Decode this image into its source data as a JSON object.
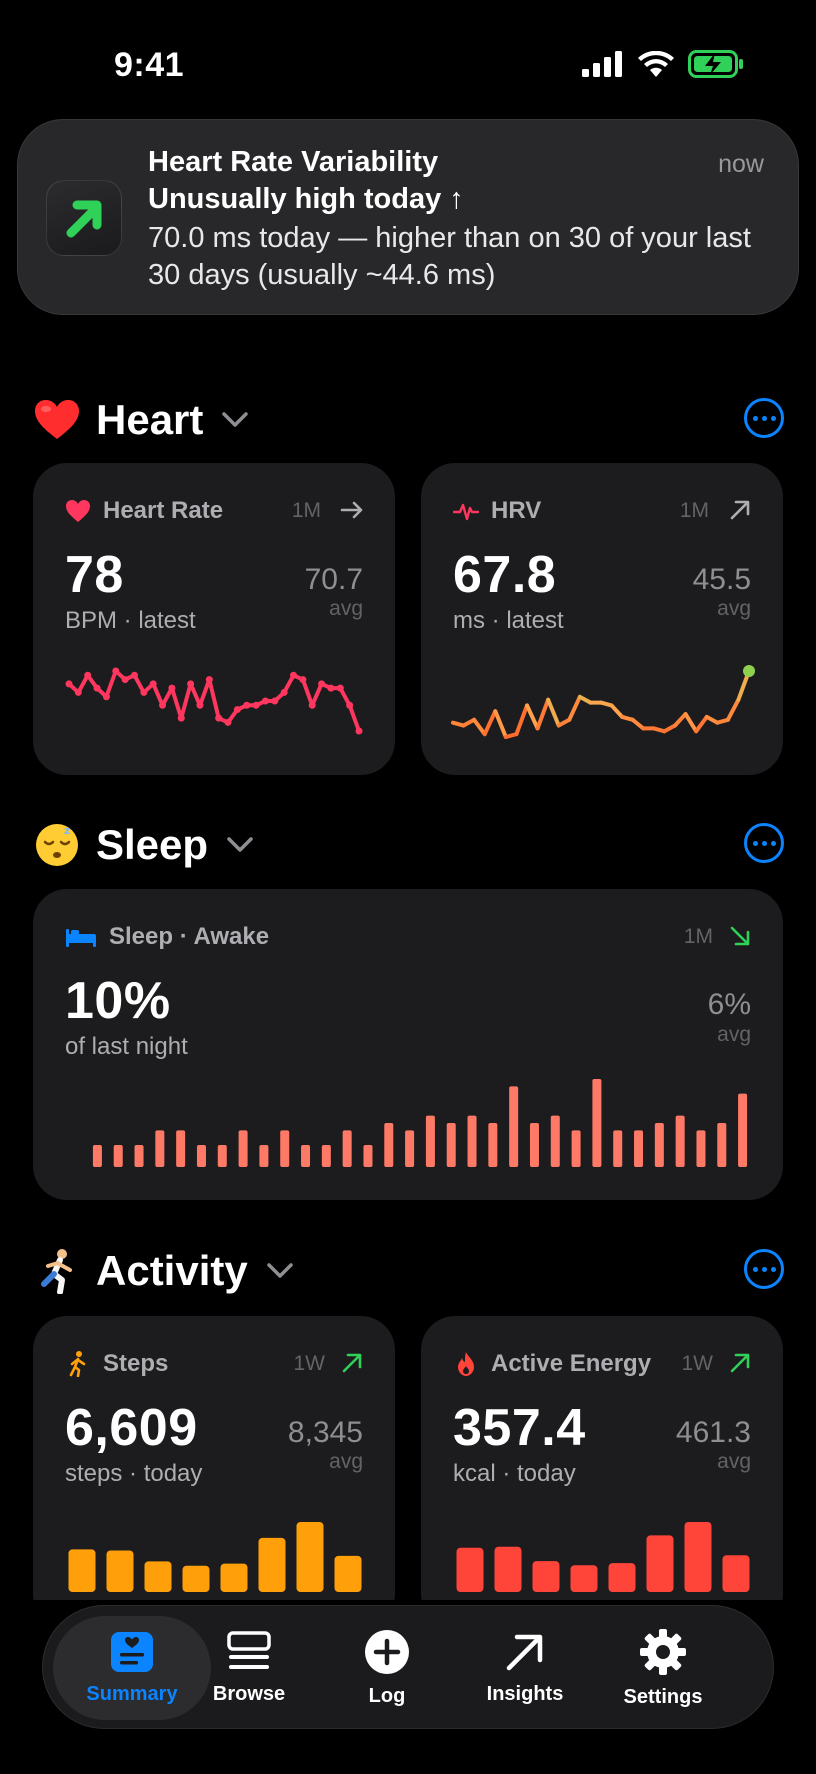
{
  "status_bar": {
    "time": "9:41"
  },
  "notification": {
    "title": "Heart Rate Variability",
    "subtitle": "Unusually high today ↑",
    "body": "70.0 ms today — higher than on 30 of your last 30 days (usually ~44.6 ms)",
    "time": "now"
  },
  "sections": {
    "heart": {
      "emoji": "heart-emoji",
      "title": "Heart"
    },
    "sleep": {
      "emoji": "sleeping-face-emoji",
      "title": "Sleep"
    },
    "activity": {
      "emoji": "runner-emoji",
      "title": "Activity"
    }
  },
  "cards": {
    "heart_rate": {
      "title": "Heart Rate",
      "range": "1M",
      "trend": "arrow-right",
      "value": "78",
      "unit": "BPM · latest",
      "avg": "70.7",
      "avg_label": "avg",
      "color": "#ff375f",
      "series": [
        72,
        70,
        74,
        71,
        69,
        75,
        73,
        74,
        70,
        72,
        67,
        71,
        64,
        72,
        67,
        73,
        64,
        63,
        66,
        67,
        67,
        68,
        68,
        70,
        74,
        73,
        67,
        72,
        71,
        71,
        67,
        61
      ]
    },
    "hrv": {
      "title": "HRV",
      "range": "1M",
      "trend": "arrow-up-right",
      "value": "67.8",
      "unit": "ms · latest",
      "avg": "45.5",
      "avg_label": "avg",
      "colors": [
        "#ff6b2c",
        "#ffa64d",
        "#8fd14f"
      ],
      "series": [
        40,
        39,
        41,
        36,
        44,
        35,
        36,
        46,
        38,
        48,
        39,
        41,
        49,
        47,
        47,
        46,
        42,
        41,
        38,
        38,
        37,
        39,
        43,
        37,
        42,
        40,
        41,
        48,
        58
      ]
    },
    "sleep_awake": {
      "title": "Sleep · Awake",
      "range": "1M",
      "trend": "arrow-down-right",
      "value": "10%",
      "unit": "of last night",
      "avg": "6%",
      "avg_label": "avg",
      "color": "#ff7a66",
      "series": [
        3,
        3,
        3,
        5,
        5,
        3,
        3,
        5,
        3,
        5,
        3,
        3,
        5,
        3,
        6,
        5,
        7,
        6,
        7,
        6,
        11,
        6,
        7,
        5,
        12,
        5,
        5,
        6,
        7,
        5,
        6,
        10
      ]
    },
    "steps": {
      "title": "Steps",
      "range": "1W",
      "trend": "arrow-up-right",
      "value": "6,609",
      "unit": "steps · today",
      "avg": "8,345",
      "avg_label": "avg",
      "color": "#ff9f0a",
      "series": [
        7800,
        7600,
        5600,
        4800,
        5200,
        9900,
        12800,
        6609
      ]
    },
    "active_energy": {
      "title": "Active Energy",
      "range": "1W",
      "trend": "arrow-up-right",
      "value": "357.4",
      "unit": "kcal · today",
      "avg": "461.3",
      "avg_label": "avg",
      "color": "#ff453a",
      "series": [
        430,
        440,
        300,
        260,
        280,
        550,
        680,
        357.4
      ]
    }
  },
  "tab_bar": {
    "items": [
      {
        "label": "Summary",
        "icon": "summary-icon",
        "active": true
      },
      {
        "label": "Browse",
        "icon": "browse-icon"
      },
      {
        "label": "Log",
        "icon": "plus-circle-icon"
      },
      {
        "label": "Insights",
        "icon": "arrow-up-right-icon"
      },
      {
        "label": "Settings",
        "icon": "gear-icon"
      }
    ]
  },
  "colors": {
    "accent": "#0a84ff",
    "card_bg": "#1c1c1e",
    "trend_green": "#30d158"
  }
}
